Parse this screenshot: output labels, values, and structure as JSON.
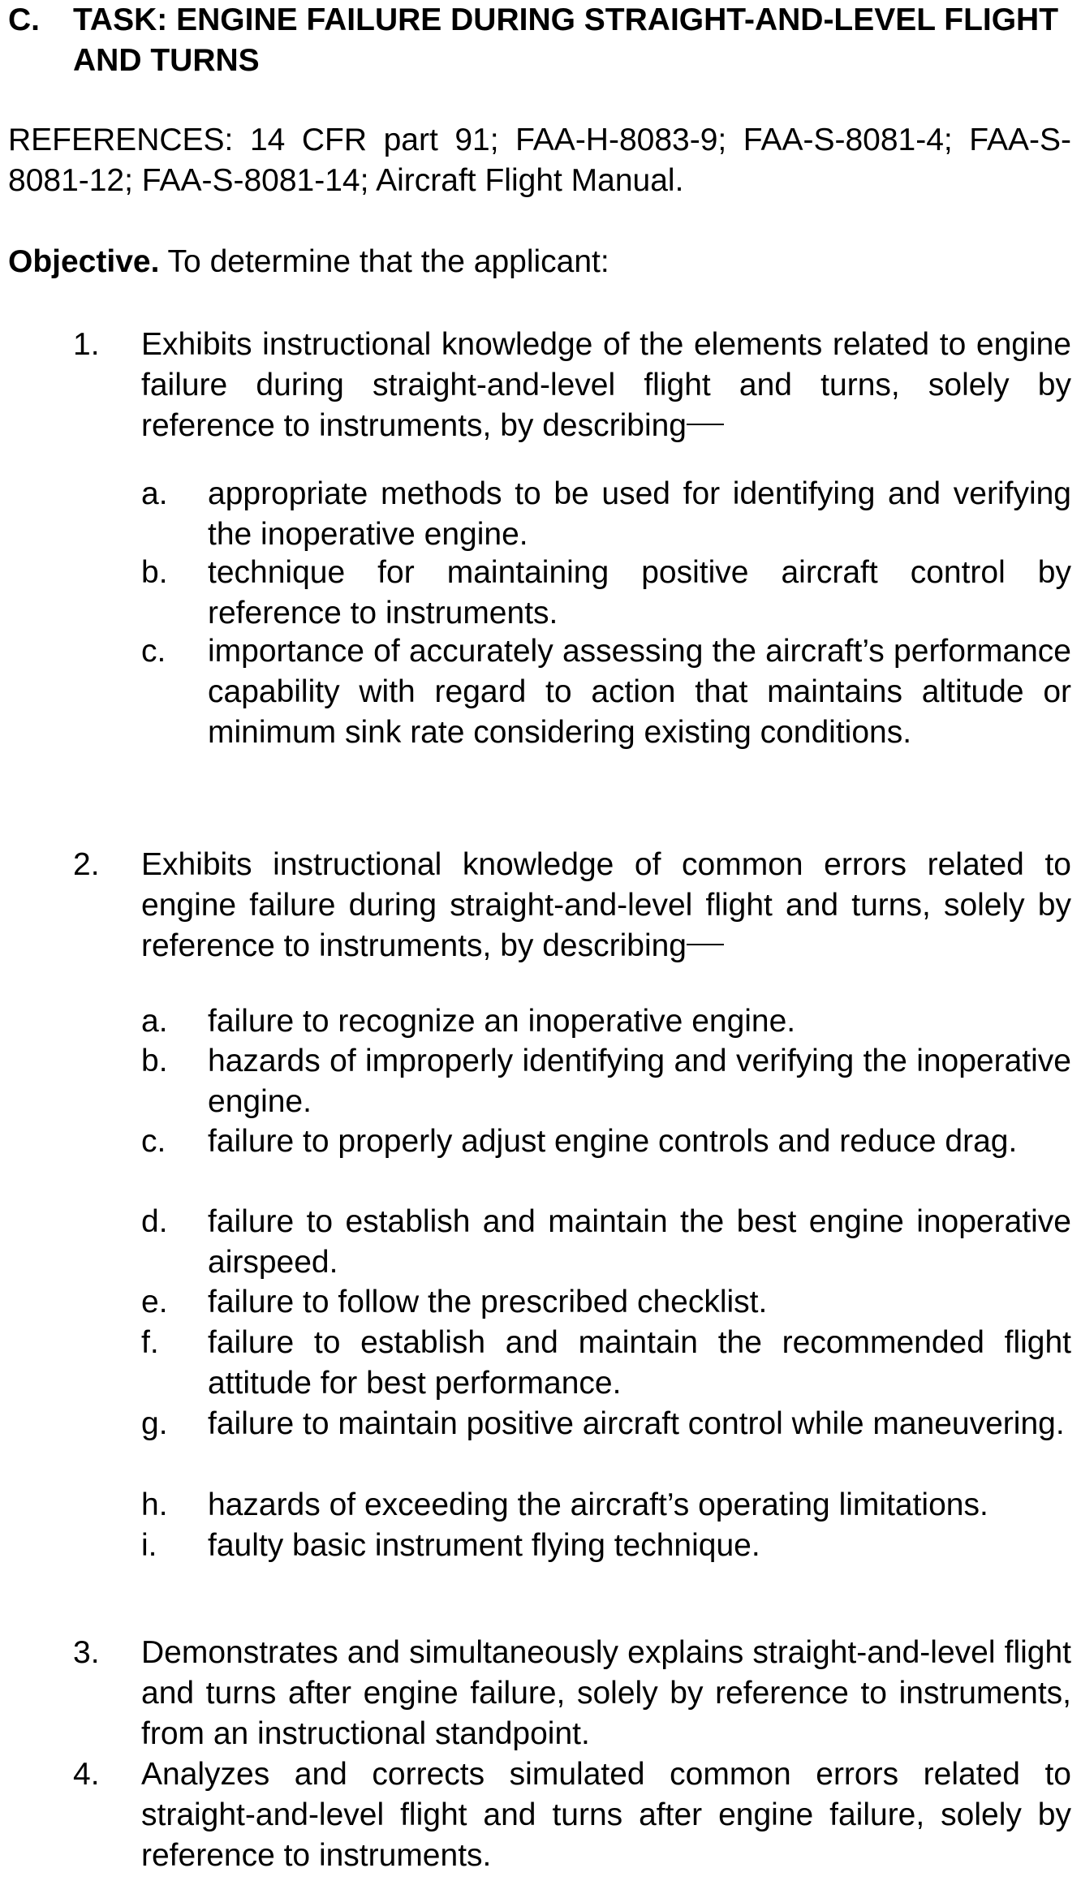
{
  "heading": {
    "letter": "C.",
    "title": "TASK: ENGINE FAILURE DURING STRAIGHT-AND-LEVEL FLIGHT AND TURNS"
  },
  "references": "REFERENCES: 14 CFR part 91; FAA-H-8083-9; FAA-S-8081-4; FAA-S-8081-12; FAA-S-8081-14; Aircraft Flight Manual.",
  "objective": {
    "label": "Objective.",
    "text": " To determine that the applicant:"
  },
  "items": [
    {
      "num": "1.",
      "text": "Exhibits instructional knowledge of the elements related to engine failure during straight-and-level flight and turns, solely by reference to instruments, by describing",
      "subs": [
        {
          "num": "a.",
          "text": "appropriate methods to be used for identifying and verifying the inoperative engine."
        },
        {
          "num": "b.",
          "text": "technique for maintaining positive aircraft control by reference to instruments."
        },
        {
          "num": "c.",
          "text": "importance of accurately assessing the aircraft’s performance capability with regard to action that maintains altitude or minimum sink rate considering existing conditions."
        }
      ]
    },
    {
      "num": "2.",
      "text": "Exhibits instructional knowledge of common errors related to engine failure during straight-and-level flight and turns, solely by reference to instruments, by describing",
      "subs": [
        {
          "num": "a.",
          "text": "failure to recognize an inoperative engine."
        },
        {
          "num": "b.",
          "text": "hazards of improperly identifying and verifying the inoperative engine."
        },
        {
          "num": "c.",
          "text": "failure to properly adjust engine controls and reduce drag."
        },
        {
          "num": "d.",
          "text": "failure to establish and maintain the best engine inoperative airspeed."
        },
        {
          "num": "e.",
          "text": "failure to follow the prescribed checklist."
        },
        {
          "num": "f.",
          "text": "failure to establish and maintain the recommended flight attitude for best performance."
        },
        {
          "num": "g.",
          "text": "failure to maintain positive aircraft control while maneuvering."
        },
        {
          "num": "h.",
          "text": "hazards of exceeding the aircraft’s operating limitations."
        },
        {
          "num": "i.",
          "text": "faulty basic instrument flying technique."
        }
      ]
    },
    {
      "num": "3.",
      "text": "Demonstrates and simultaneously explains straight-and-level flight and turns after engine failure, solely by reference to instruments, from an instructional standpoint."
    },
    {
      "num": "4.",
      "text": "Analyzes and corrects simulated common errors related to straight-and-level flight and turns after engine failure, solely by reference to instruments."
    }
  ]
}
